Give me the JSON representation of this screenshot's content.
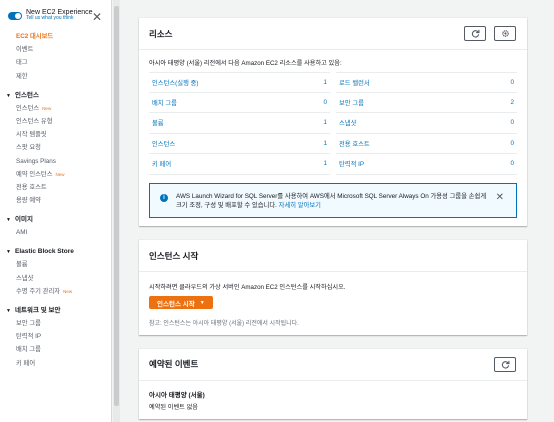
{
  "sidebar": {
    "toggle_title": "New EC2 Experience",
    "toggle_sub": "Tell us what you think",
    "top_items": [
      "EC2 대시보드",
      "이벤트",
      "태그",
      "제한"
    ],
    "sections": [
      {
        "title": "인스턴스",
        "items": [
          {
            "label": "인스턴스",
            "new": "New"
          },
          {
            "label": "인스턴스 유형",
            "new": ""
          },
          {
            "label": "시작 템플릿",
            "new": ""
          },
          {
            "label": "스팟 요청",
            "new": ""
          },
          {
            "label": "Savings Plans",
            "new": ""
          },
          {
            "label": "예약 인스턴스",
            "new": "New"
          },
          {
            "label": "전용 호스트",
            "new": ""
          },
          {
            "label": "용량 예약",
            "new": ""
          }
        ]
      },
      {
        "title": "이미지",
        "items": [
          {
            "label": "AMI",
            "new": ""
          }
        ]
      },
      {
        "title": "Elastic Block Store",
        "items": [
          {
            "label": "볼륨",
            "new": ""
          },
          {
            "label": "스냅샷",
            "new": ""
          },
          {
            "label": "수명 주기 관리자",
            "new": "New"
          }
        ]
      },
      {
        "title": "네트워크 및 보안",
        "items": [
          {
            "label": "보안 그룹",
            "new": ""
          },
          {
            "label": "탄력적 IP",
            "new": ""
          },
          {
            "label": "배치 그룹",
            "new": ""
          },
          {
            "label": "키 페어",
            "new": ""
          }
        ]
      }
    ]
  },
  "resources": {
    "title": "리소스",
    "description": "아시아 태평양 (서울) 리전에서 다음 Amazon EC2 리소스를 사용하고 있음:",
    "left": [
      {
        "label": "인스턴스(실행 중)",
        "count": "1"
      },
      {
        "label": "배치 그룹",
        "count": "0"
      },
      {
        "label": "볼륨",
        "count": "1"
      },
      {
        "label": "인스턴스",
        "count": "1"
      },
      {
        "label": "키 페어",
        "count": "1"
      }
    ],
    "right": [
      {
        "label": "로드 밸런서",
        "count": "0"
      },
      {
        "label": "보안 그룹",
        "count": "2"
      },
      {
        "label": "스냅샷",
        "count": "0"
      },
      {
        "label": "전용 호스트",
        "count": "0"
      },
      {
        "label": "탄력적 IP",
        "count": "0"
      }
    ],
    "info_text": "AWS Launch Wizard for SQL Server를 사용하여 AWS에서 Microsoft SQL Server Always On 가용성 그룹을 손쉽게 크기 조정, 구성 및 배포할 수 있습니다.",
    "info_link": "자세히 알아보기"
  },
  "launch": {
    "title": "인스턴스 시작",
    "description": "시작하려면 클라우드의 가상 서버인 Amazon EC2 인스턴스를 시작하십시오.",
    "button": "인스턴스 시작",
    "note": "참고: 인스턴스는 아시아 태평양 (서울) 리전에서 시작됩니다."
  },
  "events": {
    "title": "예약된 이벤트",
    "region": "아시아 태평양 (서울)",
    "status": "예약된 이벤트 없음"
  },
  "colors": {
    "accent": "#ec7211",
    "link": "#0073bb"
  }
}
